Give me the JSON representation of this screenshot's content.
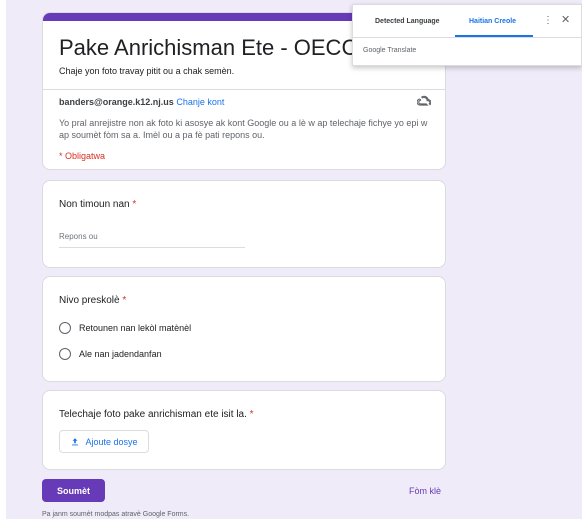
{
  "form": {
    "title": "Pake Anrichisman Ete - OECC",
    "description": "Chaje yon foto travay pitit ou a chak semèn.",
    "email": "banders@orange.k12.nj.us",
    "switch_account": "Chanje kont",
    "notice": "Yo pral anrejistre non ak foto ki asosye ak kont Google ou a lè w ap telechaje fichye yo epi w ap soumèt fòm sa a. Imèl ou a pa fè pati repons ou.",
    "required_note": "* Obligatwa",
    "accent_color": "#673ab7"
  },
  "questions": {
    "q1": {
      "title": "Non timoun nan",
      "required": "*",
      "placeholder": "Repons ou"
    },
    "q2": {
      "title": "Nivo preskolè",
      "required": "*",
      "options": [
        "Retounen nan lekòl matènèl",
        "Ale nan jadendanfan"
      ]
    },
    "q3": {
      "title": "Telechaje foto pake anrichisman ete isit la.",
      "required": "*",
      "upload_label": "Ajoute dosye"
    }
  },
  "actions": {
    "submit": "Soumèt",
    "clear": "Fòm klè"
  },
  "footer": {
    "text": "Pa janm soumèt modpas atravè Google Forms."
  },
  "translate_popup": {
    "tab_detected": "Detected Language",
    "tab_target": "Haitian Creole",
    "more_icon": "⋮",
    "close_icon": "✕",
    "brand": "Google Translate"
  }
}
